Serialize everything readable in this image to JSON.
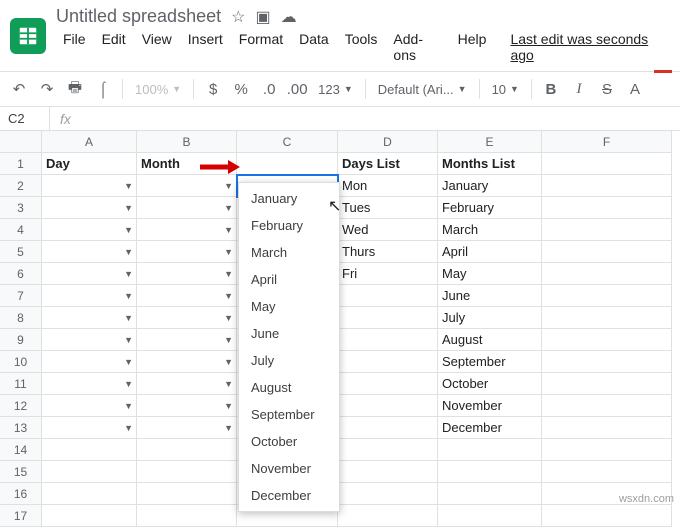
{
  "title": {
    "doc": "Untitled spreadsheet",
    "lastedit": "Last edit was seconds ago"
  },
  "menus": {
    "file": "File",
    "edit": "Edit",
    "view": "View",
    "insert": "Insert",
    "format": "Format",
    "data": "Data",
    "tools": "Tools",
    "addons": "Add-ons",
    "help": "Help"
  },
  "toolbar": {
    "zoom": "100%",
    "currency": "$",
    "percent": "%",
    "dec_dec": ".0",
    "dec_inc": ".00",
    "numfmt": "123",
    "font": "Default (Ari...",
    "size": "10",
    "bold": "B",
    "italic": "I",
    "strike": "S",
    "color": "A"
  },
  "namebox": "C2",
  "fx": "fx",
  "cols": {
    "A": "A",
    "B": "B",
    "C": "C",
    "D": "D",
    "E": "E",
    "F": "F"
  },
  "rows": {
    "r1": "1",
    "r2": "2",
    "r3": "3",
    "r4": "4",
    "r5": "5",
    "r6": "6",
    "r7": "7",
    "r8": "8",
    "r9": "9",
    "r10": "10",
    "r11": "11",
    "r12": "12",
    "r13": "13",
    "r14": "14",
    "r15": "15",
    "r16": "16",
    "r17": "17"
  },
  "h": {
    "A": "Day",
    "B": "Month",
    "D": "Days List",
    "E": "Months List"
  },
  "daysList": {
    "d1": "Mon",
    "d2": "Tues",
    "d3": "Wed",
    "d4": "Thurs",
    "d5": "Fri"
  },
  "monthsList": {
    "m1": "January",
    "m2": "February",
    "m3": "March",
    "m4": "April",
    "m5": "May",
    "m6": "June",
    "m7": "July",
    "m8": "August",
    "m9": "September",
    "m10": "October",
    "m11": "November",
    "m12": "December"
  },
  "dropdown": {
    "o1": "January",
    "o2": "February",
    "o3": "March",
    "o4": "April",
    "o5": "May",
    "o6": "June",
    "o7": "July",
    "o8": "August",
    "o9": "September",
    "o10": "October",
    "o11": "November",
    "o12": "December"
  },
  "watermark": "wsxdn.com"
}
